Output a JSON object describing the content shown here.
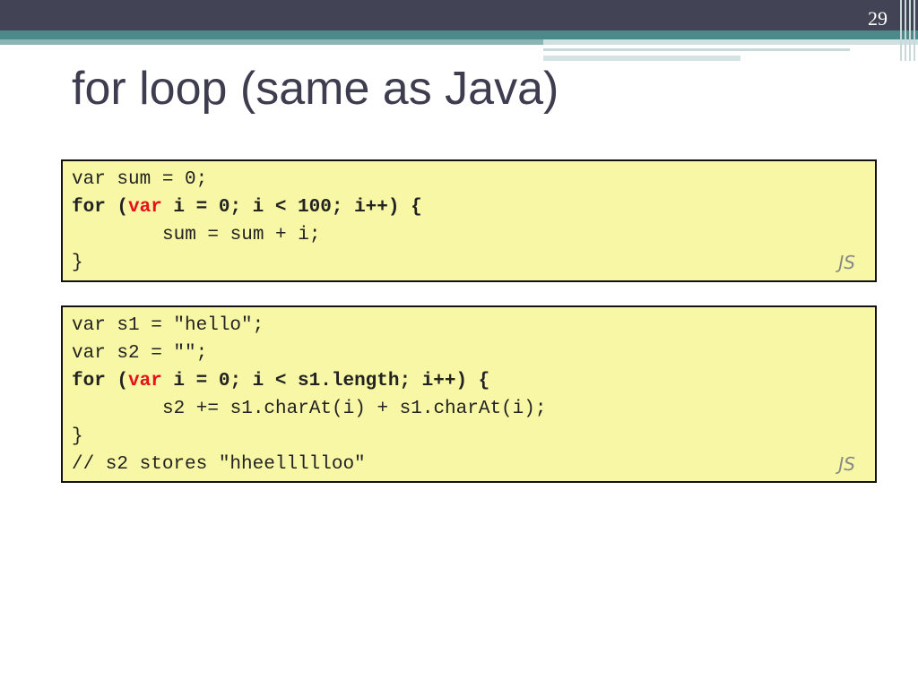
{
  "slide": {
    "number": "29",
    "title": "for loop (same as Java)"
  },
  "code_blocks": [
    {
      "language_tag": "JS",
      "lines": [
        {
          "text": "var sum = 0;"
        },
        {
          "kw_for": "for (",
          "kw_var": "var",
          "rest": " i = 0; i < 100; i++) {"
        },
        {
          "text": "sum = sum + i;"
        },
        {
          "text": "}"
        }
      ]
    },
    {
      "language_tag": "JS",
      "lines": [
        {
          "text": "var s1 = \"hello\";"
        },
        {
          "text": "var s2 = \"\";"
        },
        {
          "kw_for": "for (",
          "kw_var": "var",
          "rest": " i = 0; i < s1.length; i++) {"
        },
        {
          "text": "s2 += s1.charAt(i) + s1.charAt(i);"
        },
        {
          "text": "}"
        },
        {
          "text": "// s2 stores \"hheellllloo\""
        }
      ]
    }
  ],
  "colors": {
    "header_dark": "#434356",
    "header_teal": "#4a8a8a",
    "code_background": "#f7f7a6",
    "keyword_red": "#e8101a",
    "title_text": "#3d3d4f"
  }
}
